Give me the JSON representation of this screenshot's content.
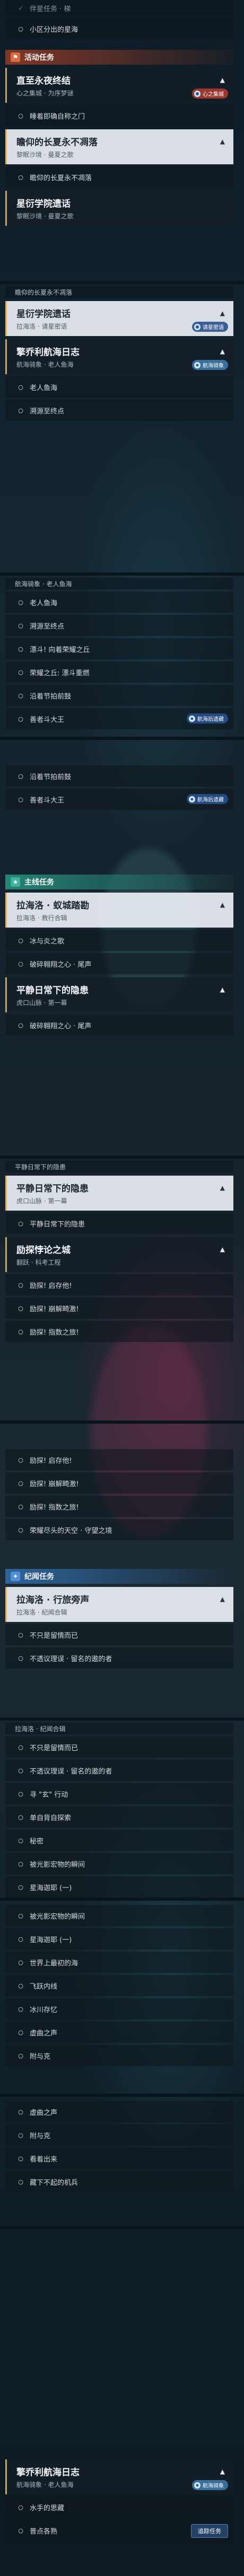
{
  "top": {
    "row1": "伴星任务 · 梯",
    "row2": "小区分出的星海"
  },
  "event_header": "活动任务",
  "main_header_1": "主线任务",
  "main_header_2": "主线任务",
  "side_header": "纪闻任务",
  "cards": {
    "c1": {
      "title": "直至永夜终结",
      "sub": "心之集城 · 为序梦谜",
      "badge": "心之集城"
    },
    "c1_task": "睡着即确自称之门",
    "c2": {
      "title": "瞻仰的长夏永不凋落",
      "sub": "黎眠沙境 · 曼夏之歌"
    },
    "c2_task": "瞻仰的长夏永不凋落",
    "c3a": {
      "title": "星衍学院遗话",
      "sub": "黎眠沙境 · 曼夏之歌"
    },
    "c3_strip": "瞻仰的长夏永不凋落",
    "c3b": {
      "title": "星衍学院遗话",
      "sub": "拉海洛 · 请星密语",
      "badge": "请星密语"
    },
    "c4": {
      "title": "擎乔利航海日志",
      "sub": "航海骑象 · 老人鱼海",
      "badge": "航海骑象"
    },
    "c4_tasks": [
      "老人鱼海",
      "溯源至终点"
    ],
    "c5_strip": "航海骑象 · 老人鱼海",
    "c5_tasks": [
      "老人鱼海",
      "溯源至终点",
      "漂斗! 向着荣耀之丘",
      "荣耀之丘: 漂斗重燃",
      "沿着节拍前鼓",
      "善者斗大王"
    ],
    "c5_badge": "航海后遗藏",
    "c6_tasks": [
      "沿着节拍前鼓",
      "善者斗大王"
    ],
    "c6_badge": "航海后遗藏",
    "c7": {
      "title": "拉海洛 · 蚁城踏勘",
      "sub": "拉海洛 · 救行合辑"
    },
    "c7_tasks": [
      "冰与炎之歌",
      "破碎翱翔之心 · 尾声"
    ],
    "c8": {
      "title": "平静日常下的隐患",
      "sub": "虎口山脉 · 第一幕"
    },
    "c8_tasks": [
      "破碎翱翔之心 · 尾声"
    ],
    "c9_strip": "平静日常下的隐患",
    "c9": {
      "title": "平静日常下的隐患",
      "sub": "虎口山脉 · 第一幕"
    },
    "c9_tasks": [
      "平静日常下的隐患"
    ],
    "c10": {
      "title": "励探悖论之城",
      "sub": "翻跃 · 科考工程"
    },
    "c10_tasks": [
      "励探! 启存他!",
      "励探! 崩解畸激!",
      "励探! 指数之旅!"
    ],
    "c11_tasks": [
      "励探! 启存他!",
      "励探! 崩解畸激!",
      "励探! 指数之旅!",
      "荣耀尽头的天空 · 守望之境"
    ],
    "c12": {
      "title": "拉海洛 · 行旅旁声",
      "sub": "拉海洛 · 纪闻合辑"
    },
    "c12_tasks": [
      "不只是留情而已",
      "不透议理误 · 留名的遨的者"
    ],
    "c13_strip": "拉海洛 · 纪闻合辑",
    "c13_tasks": [
      "不只是留情而已",
      "不透议理误 · 留名的遨的者",
      "寻 \"玄\" 行动",
      "单自背自探索",
      "秘密",
      "被光影宏物的瞬间",
      "星海迦耶 (一)"
    ],
    "c14_tasks": [
      "被光影宏物的瞬间",
      "星海迦耶 (一)",
      "世界上最初的海",
      "飞跃内线",
      "冰川存忆",
      "虚曲之声",
      "附与克",
      "虚曲之声",
      "附与克",
      "看着出来",
      "藏下不起的机兵"
    ],
    "c15": {
      "title": "擎乔利航海日志",
      "sub": "航海骑象 · 老人鱼海",
      "badge": "航海骑象"
    },
    "c15_tasks": [
      "水手的思藏",
      "普点各熟"
    ],
    "c15_button": "追踪任务"
  },
  "icons": {
    "collapse": "chevron-up-icon",
    "event_tag": "flag-icon",
    "main_tag": "star-icon",
    "side_tag": "book-icon"
  },
  "colors": {
    "event_accent": "#d66b3f",
    "main_accent": "#3fb39a",
    "side_accent": "#4f8ed8",
    "card_border": "#c9a46a"
  }
}
